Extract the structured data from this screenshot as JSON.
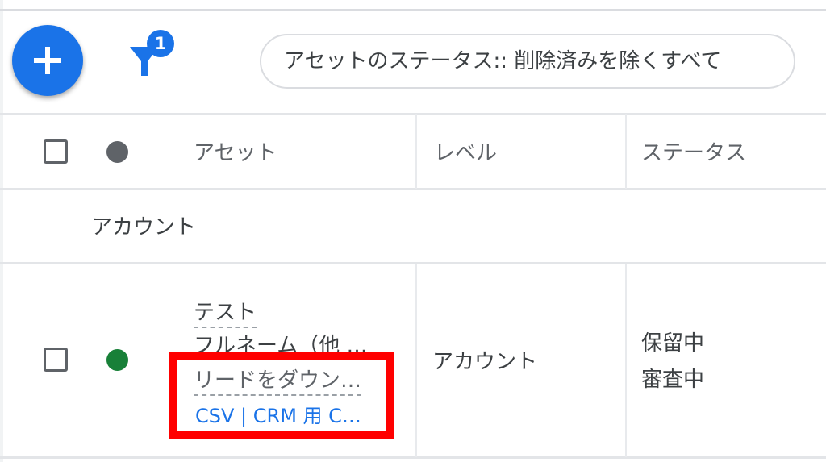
{
  "toolbar": {
    "add_icon": "plus-icon",
    "filter_icon": "filter-icon",
    "filter_badge": "1",
    "filter_chip": "アセットのステータス:: 削除済みを除くすべて"
  },
  "table": {
    "headers": {
      "status_dot_color": "#5f6368",
      "asset": "アセット",
      "level": "レベル",
      "status": "ステータス"
    },
    "group_label": "アカウント",
    "rows": [
      {
        "status_dot_color": "#188038",
        "asset_title": "テスト",
        "asset_name": "フルネーム（他 …",
        "asset_action": "リードをダウン…",
        "asset_link": "CSV | CRM 用 C…",
        "level": "アカウント",
        "status_line1": "保留中",
        "status_line2": "審査中"
      }
    ]
  },
  "colors": {
    "accent": "#1a73e8",
    "highlight_box": "#ff0000",
    "enabled_dot": "#188038"
  }
}
